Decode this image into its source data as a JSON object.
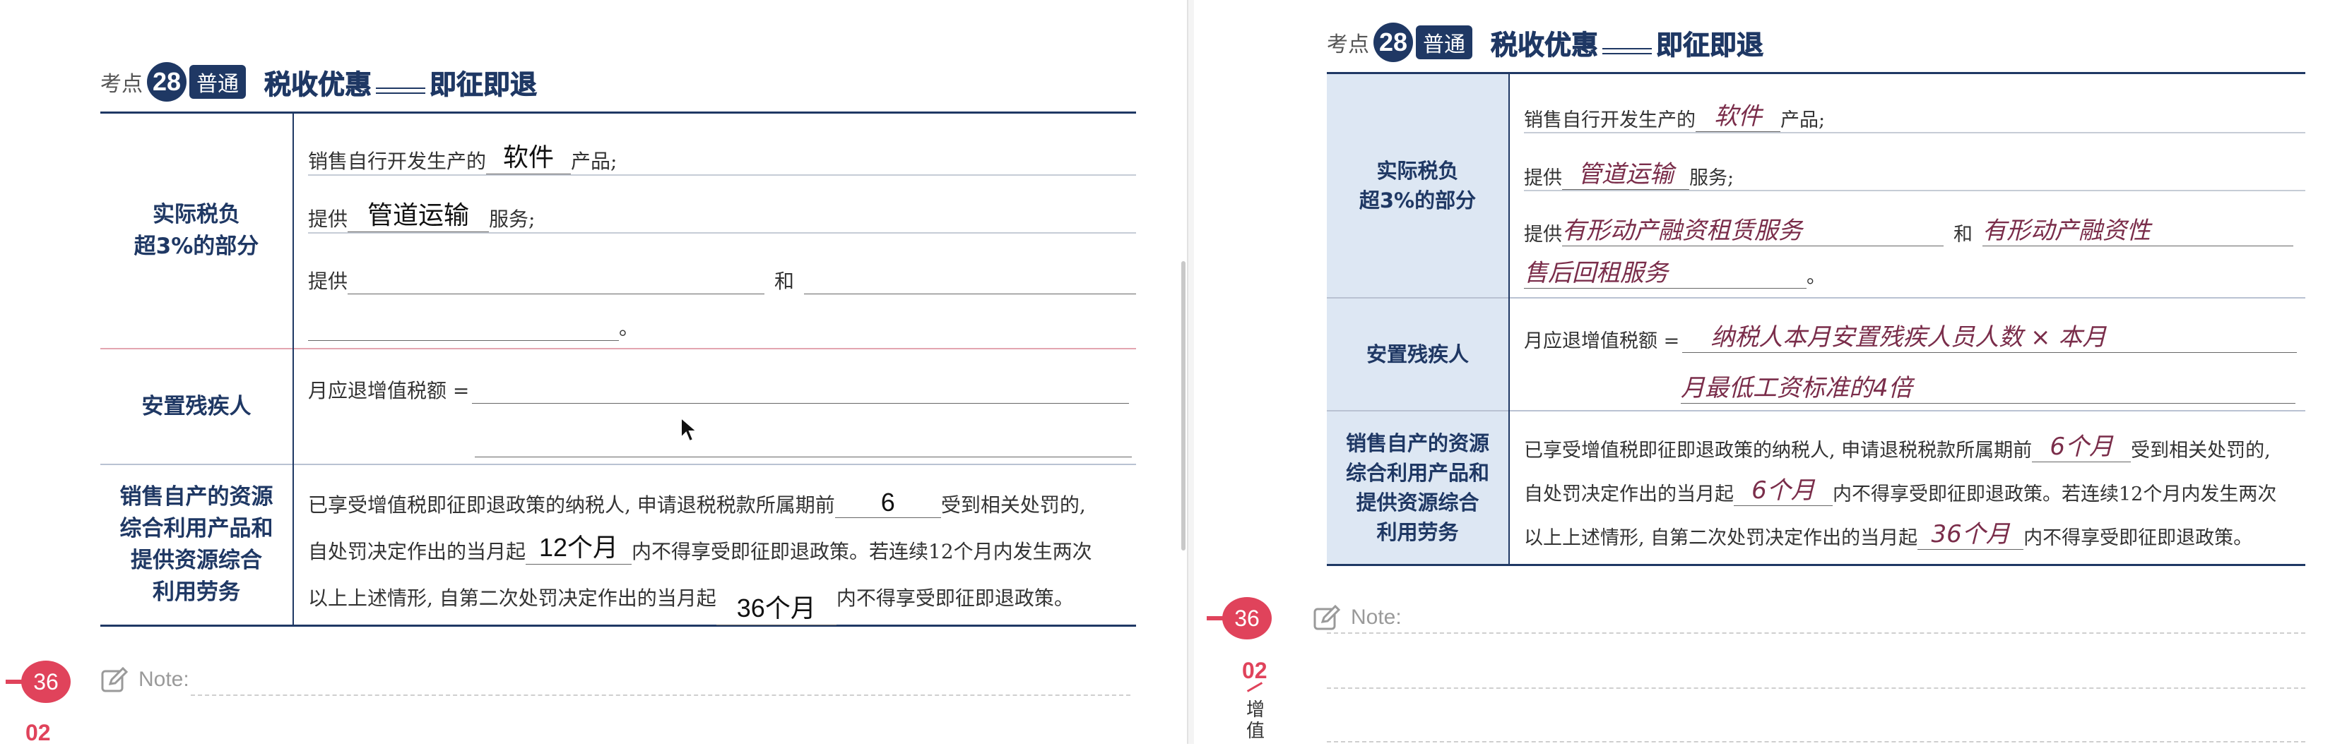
{
  "heading": {
    "prefix": "考点",
    "number": "28",
    "level": "普通",
    "title_part1": "税收优惠",
    "title_part2": "即征即退"
  },
  "rows": {
    "row1_label": "实际税负\n超3%的部分",
    "line1_pre": "销售自行开发生产的",
    "line1_post": "产品;",
    "line2_pre": "提供",
    "line2_post": "服务;",
    "line3_pre": "提供",
    "line3_mid": "和",
    "line3_end": "。",
    "row2_label": "安置残疾人",
    "row2_pre": "月应退增值税额 =",
    "row3_label": "销售自产的资源\n综合利用产品和\n提供资源综合\n利用劳务",
    "p1_pre": "已享受增值税即征即退政策的纳税人, 申请退税税款所属期前",
    "p1_post": "受到相关处罚的,",
    "p2_pre": "自处罚决定作出的当月起",
    "p2_post": "内不得享受即征即退政策。若连续12个月内发生两次",
    "p3_pre": "以上上述情形, 自第二次处罚决定作出的当月起",
    "p3_post": "内不得享受即征即退政策。"
  },
  "left_answers": {
    "software": "软件",
    "pipeline": "管道运输",
    "months_before": "6",
    "months_1": "12个月",
    "months_2": "36个月"
  },
  "right_answers": {
    "software": "软件",
    "pipeline": "管道运输",
    "lease1": "有形动产融资租赁服务",
    "lease2a": "有形动产融资性",
    "lease2b": "售后回租服务",
    "formula_a": "纳税人本月安置残疾人员人数 × 本月",
    "formula_b": "月最低工资标准的4倍",
    "months_before": "6个月",
    "months_1": "6个月",
    "months_2": "36个月"
  },
  "page_number": "36",
  "note_label": "Note:",
  "chapter_number": "02",
  "chapter_text": "增值",
  "colors": {
    "navy": "#1f3864",
    "pink": "#e0435b",
    "label_bg": "#dde7f3",
    "handwriting": "#7a2d4a"
  },
  "icons": [
    "note-edit-icon",
    "mouse-cursor-icon"
  ]
}
